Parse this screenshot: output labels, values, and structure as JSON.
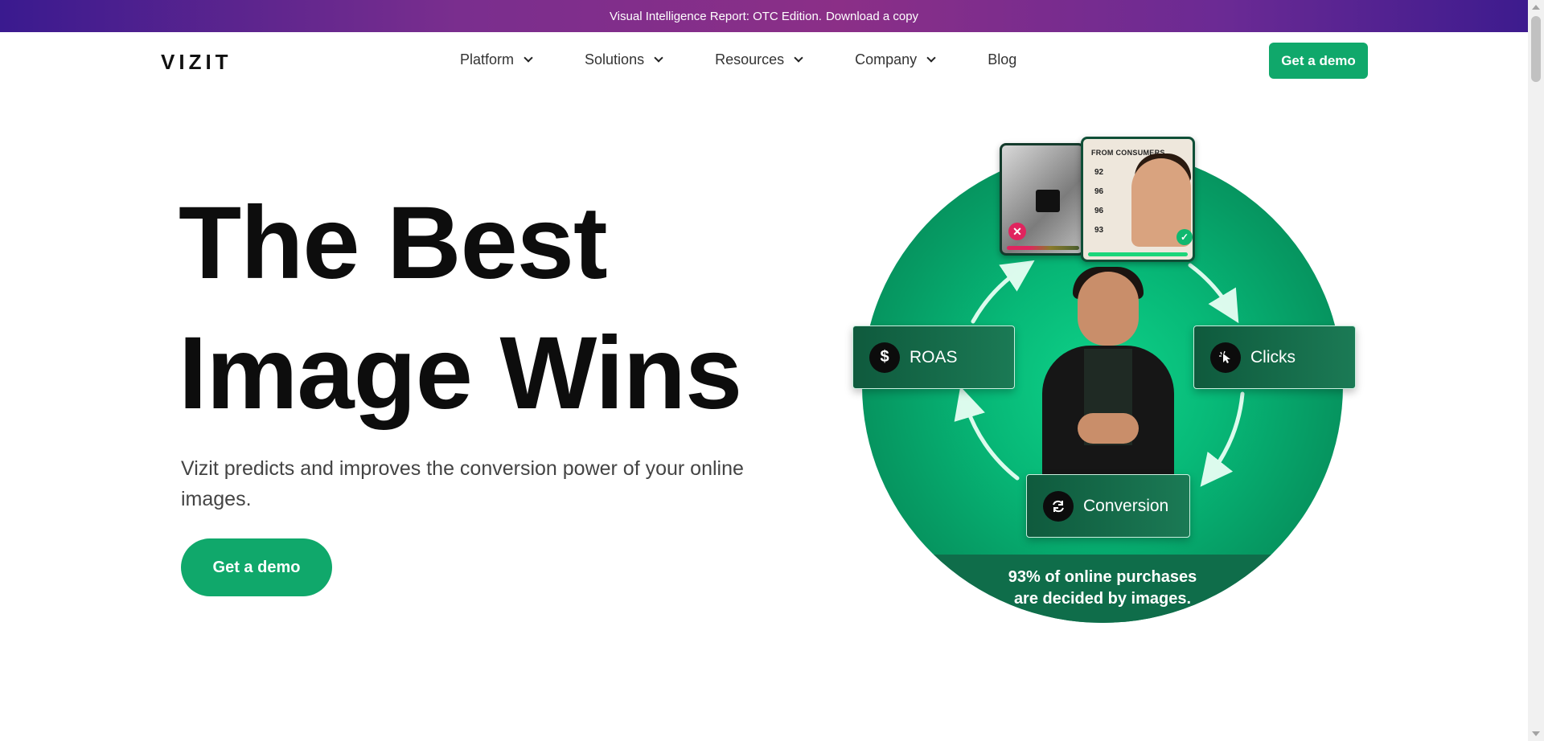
{
  "promo": {
    "text": "Visual Intelligence Report: OTC Edition.",
    "link": "Download a copy"
  },
  "nav": {
    "logo": "VIZIT",
    "items": [
      {
        "label": "Platform",
        "has_dropdown": true
      },
      {
        "label": "Solutions",
        "has_dropdown": true
      },
      {
        "label": "Resources",
        "has_dropdown": true
      },
      {
        "label": "Company",
        "has_dropdown": true
      },
      {
        "label": "Blog",
        "has_dropdown": false
      }
    ],
    "cta": "Get a demo"
  },
  "hero": {
    "title_line1": "The Best",
    "title_line2": "Image Wins",
    "subtitle": "Vizit predicts and improves the conversion power of your online images.",
    "cta": "Get a demo"
  },
  "illustration": {
    "cards": {
      "roas": {
        "label": "ROAS",
        "icon": "dollar-icon"
      },
      "clicks": {
        "label": "Clicks",
        "icon": "cursor-click-icon"
      },
      "conversion": {
        "label": "Conversion",
        "icon": "refresh-icon"
      }
    },
    "stat_line1": "93% of online purchases",
    "stat_line2": "are decided by images.",
    "thumb_title": "FROM CONSUMERS",
    "thumb_scores": [
      "92",
      "96",
      "96",
      "93"
    ]
  },
  "colors": {
    "brand_green": "#10a86b",
    "banner_purple": "#7a2e8e",
    "dark_green": "#0f6d4a"
  }
}
